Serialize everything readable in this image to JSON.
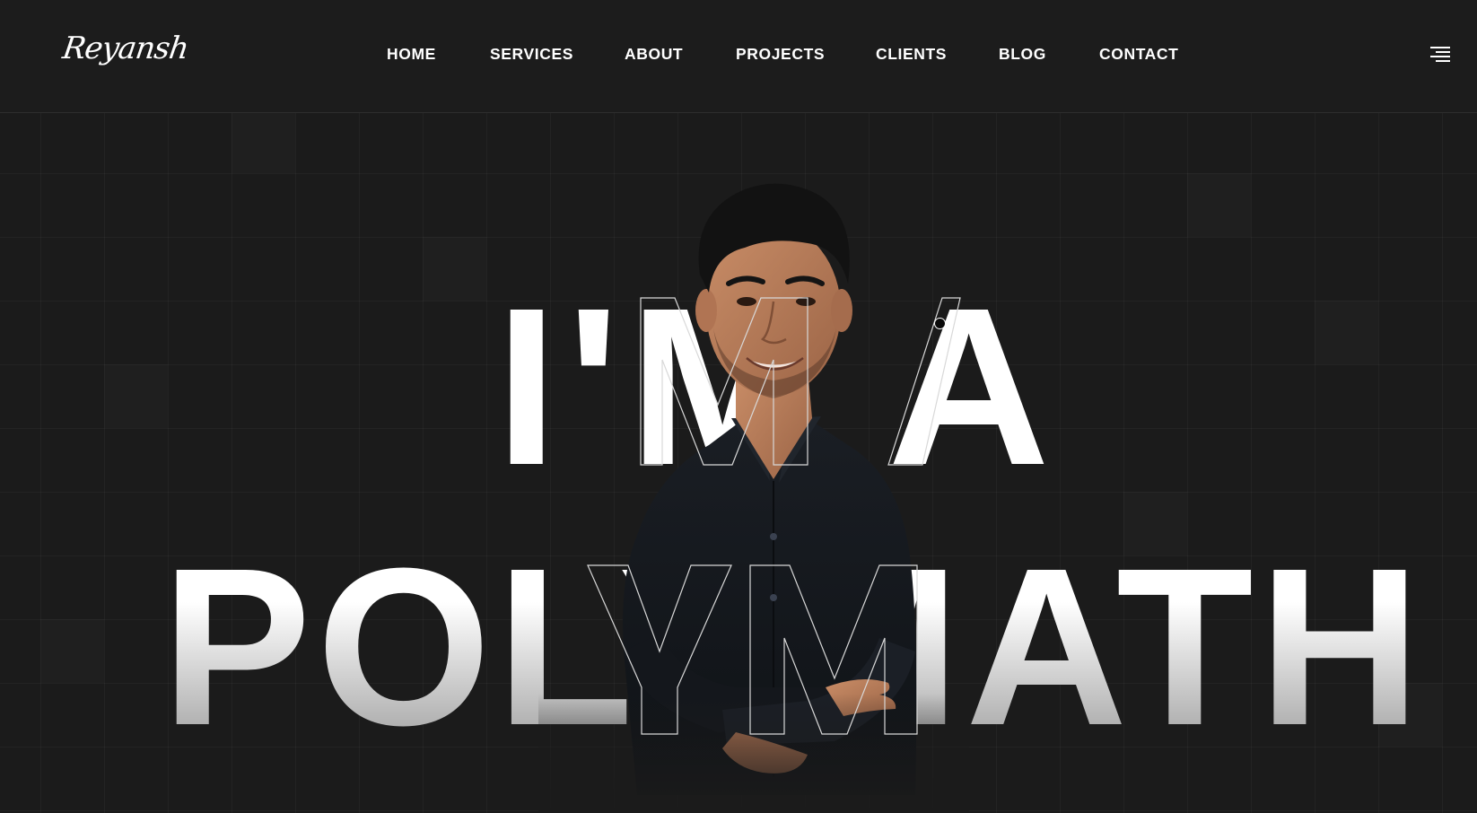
{
  "header": {
    "logo_text": "Reyansh",
    "nav": [
      {
        "label": "HOME"
      },
      {
        "label": "SERVICES"
      },
      {
        "label": "ABOUT"
      },
      {
        "label": "PROJECTS"
      },
      {
        "label": "CLIENTS"
      },
      {
        "label": "BLOG"
      },
      {
        "label": "CONTACT"
      }
    ],
    "menu_icon": "hamburger-menu-icon"
  },
  "hero": {
    "line1": "I'M A",
    "line2": "POLYMATH"
  },
  "colors": {
    "background": "#1b1b1b",
    "header_bg": "#1c1c1c",
    "text": "#ffffff",
    "shirt": "#15181d",
    "skin": "#b87a58",
    "hair": "#121212"
  }
}
